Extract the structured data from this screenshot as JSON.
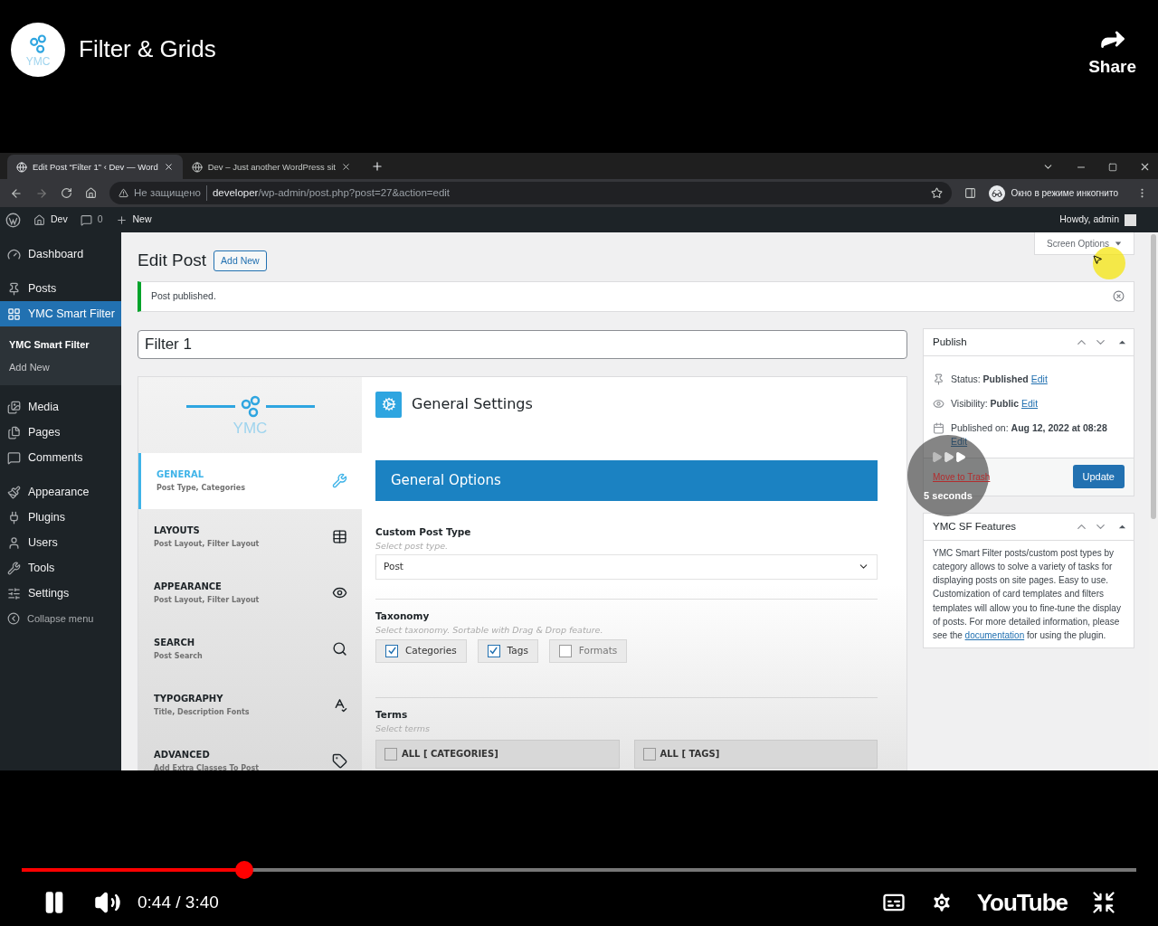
{
  "player": {
    "channel_logo_text": "YMC",
    "title": "Filter & Grids",
    "share_label": "Share",
    "playing": true,
    "progress": {
      "level": 0.2
    },
    "time": "0:44 / 3:40",
    "seek_overlay": "5 seconds",
    "brand": "YouTube"
  },
  "browser": {
    "tabs": [
      {
        "title": "Edit Post “Filter 1” ‹ Dev — Word",
        "selected": true
      },
      {
        "title": "Dev – Just another WordPress sit",
        "selected": false
      }
    ],
    "security": "Не защищено",
    "url_host": "developer",
    "url_path": "/wp-admin/post.php?post=27&action=edit",
    "incognito": "Окно в режиме инкогнито"
  },
  "admin_bar": {
    "site": "Dev",
    "comments": "0",
    "new": "New",
    "howdy": "Howdy, admin"
  },
  "sidebar": {
    "groups": [
      [
        {
          "label": "Dashboard",
          "selected": false
        }
      ],
      [
        {
          "label": "Posts",
          "selected": false
        },
        {
          "label": "YMC Smart Filter",
          "selected": true,
          "children": [
            {
              "label": "YMC Smart Filter",
              "selected": true
            },
            {
              "label": "Add New",
              "selected": false
            }
          ]
        }
      ],
      [
        {
          "label": "Media",
          "selected": false
        },
        {
          "label": "Pages",
          "selected": false
        },
        {
          "label": "Comments",
          "selected": false
        }
      ],
      [
        {
          "label": "Appearance",
          "selected": false
        },
        {
          "label": "Plugins",
          "selected": false
        },
        {
          "label": "Users",
          "selected": false
        },
        {
          "label": "Tools",
          "selected": false
        },
        {
          "label": "Settings",
          "selected": false
        }
      ]
    ],
    "collapse": "Collapse menu"
  },
  "screen_options": "Screen Options",
  "heading": "Edit Post",
  "add_new": "Add New",
  "notice": "Post published.",
  "post_title": "Filter 1",
  "plugin": {
    "logo_text": "YMC",
    "nav": [
      {
        "title": "GENERAL",
        "subtitle": "Post Type, Categories",
        "selected": true
      },
      {
        "title": "LAYOUTS",
        "subtitle": "Post Layout, Filter Layout",
        "selected": false
      },
      {
        "title": "APPEARANCE",
        "subtitle": "Post Layout, Filter Layout",
        "selected": false
      },
      {
        "title": "SEARCH",
        "subtitle": "Post Search",
        "selected": false
      },
      {
        "title": "TYPOGRAPHY",
        "subtitle": "Title, Description Fonts",
        "selected": false
      },
      {
        "title": "ADVANCED",
        "subtitle": "Add Extra Classes To Post",
        "selected": false
      }
    ],
    "section_title": "General Settings",
    "options_title": "General Options",
    "post_type": {
      "label": "Custom Post Type",
      "hint": "Select post type.",
      "value": "Post"
    },
    "taxonomy": {
      "label": "Taxonomy",
      "hint": "Select taxonomy. Sortable with Drag & Drop feature.",
      "options": [
        {
          "label": "Categories",
          "checked": true
        },
        {
          "label": "Tags",
          "checked": true
        },
        {
          "label": "Formats",
          "checked": false
        }
      ]
    },
    "terms": {
      "label": "Terms",
      "hint": "Select terms",
      "groups": [
        {
          "label": "ALL [ CATEGORIES]",
          "checked": false
        },
        {
          "label": "ALL [ TAGS]",
          "checked": false
        }
      ]
    }
  },
  "publish": {
    "title": "Publish",
    "rows": [
      {
        "text": "Status: **Published**",
        "link": "Edit"
      },
      {
        "text": "Visibility: **Public**",
        "link": "Edit"
      },
      {
        "text": "Published on: **Aug 12, 2022 at 08:28**",
        "link": "Edit"
      }
    ],
    "trash": "Move to Trash",
    "update": "Update"
  },
  "features": {
    "title": "YMC SF Features",
    "text_before": "YMC Smart Filter posts/custom post types by category allows to solve a variety of tasks for displaying posts on site pages. Easy to use. Customization of card templates and filters templates will allow you to fine-tune the display of posts. For more detailed information, please see the",
    "link": "documentation",
    "text_after": "for using the plugin."
  }
}
